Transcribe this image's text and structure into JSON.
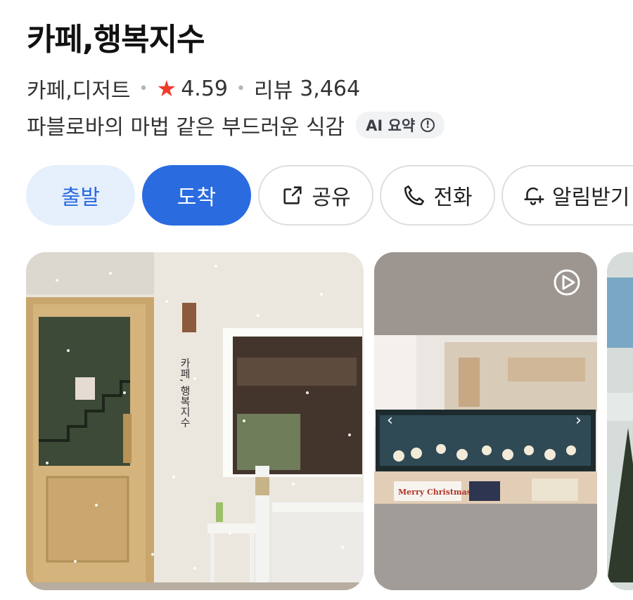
{
  "place": {
    "title": "카페,행복지수",
    "category": "카페,디저트",
    "rating": "4.59",
    "review_label": "리뷰",
    "review_count": "3,464",
    "summary": "파블로바의 마법 같은 부드러운 식감",
    "ai_badge": "AI 요약"
  },
  "actions": {
    "depart": "출발",
    "arrive": "도착",
    "share": "공유",
    "call": "전화",
    "alarm": "알림받기"
  },
  "photos": {
    "sign_text": "카페, 행복지수",
    "poster_1": "Merry Christmas"
  },
  "colors": {
    "accent_blue": "#2a6be0",
    "accent_light": "#e6effc",
    "star": "#ef3b2c"
  }
}
